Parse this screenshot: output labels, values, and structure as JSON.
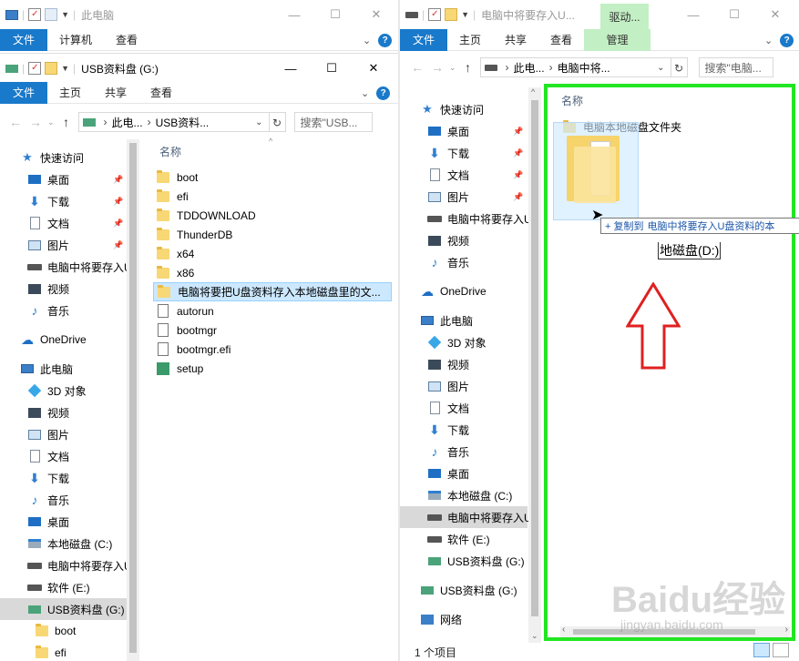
{
  "left_top_window": {
    "title": "此电脑",
    "ribbon_tabs": [
      "文件",
      "计算机",
      "查看"
    ],
    "controls": {
      "minimize": "—",
      "maximize": "☐",
      "close": "✕"
    }
  },
  "left_window": {
    "title": "USB资料盘 (G:)",
    "ribbon_tabs": [
      "文件",
      "主页",
      "共享",
      "查看"
    ],
    "address": {
      "crumb1": "此电...",
      "crumb2": "USB资料...",
      "refresh": "↻"
    },
    "search_placeholder": "搜索\"USB...",
    "nav": [
      {
        "label": "快速访问",
        "icon": "star-icon",
        "level": 0
      },
      {
        "label": "桌面",
        "icon": "desktop-icon",
        "level": 1,
        "pinned": true
      },
      {
        "label": "下载",
        "icon": "download-icon",
        "level": 1,
        "pinned": true
      },
      {
        "label": "文档",
        "icon": "document-icon",
        "level": 1,
        "pinned": true
      },
      {
        "label": "图片",
        "icon": "picture-icon",
        "level": 1,
        "pinned": true
      },
      {
        "label": "电脑中将要存入U",
        "icon": "drive-icon",
        "level": 1
      },
      {
        "label": "视频",
        "icon": "video-icon",
        "level": 1
      },
      {
        "label": "音乐",
        "icon": "music-icon",
        "level": 1
      },
      {
        "label": "OneDrive",
        "icon": "cloud-icon",
        "level": 0
      },
      {
        "label": "此电脑",
        "icon": "computer-icon",
        "level": 0
      },
      {
        "label": "3D 对象",
        "icon": "cube-icon",
        "level": 1
      },
      {
        "label": "视频",
        "icon": "video-icon",
        "level": 1
      },
      {
        "label": "图片",
        "icon": "picture-icon",
        "level": 1
      },
      {
        "label": "文档",
        "icon": "document-icon",
        "level": 1
      },
      {
        "label": "下载",
        "icon": "download-icon",
        "level": 1
      },
      {
        "label": "音乐",
        "icon": "music-icon",
        "level": 1
      },
      {
        "label": "桌面",
        "icon": "desktop-icon",
        "level": 1
      },
      {
        "label": "本地磁盘 (C:)",
        "icon": "windows-drive-icon",
        "level": 1
      },
      {
        "label": "电脑中将要存入U",
        "icon": "drive-icon",
        "level": 1
      },
      {
        "label": "软件 (E:)",
        "icon": "drive-icon",
        "level": 1
      },
      {
        "label": "USB资料盘 (G:)",
        "icon": "usb-drive-icon",
        "level": 1,
        "selected": true
      },
      {
        "label": "boot",
        "icon": "folder-icon",
        "level": 2
      },
      {
        "label": "efi",
        "icon": "folder-icon",
        "level": 2
      }
    ],
    "column_header": "名称",
    "files": [
      {
        "name": "boot",
        "type": "folder"
      },
      {
        "name": "efi",
        "type": "folder"
      },
      {
        "name": "TDDOWNLOAD",
        "type": "folder"
      },
      {
        "name": "ThunderDB",
        "type": "folder"
      },
      {
        "name": "x64",
        "type": "folder"
      },
      {
        "name": "x86",
        "type": "folder"
      },
      {
        "name": "电脑将要把U盘资料存入本地磁盘里的文...",
        "type": "folder",
        "selected": true
      },
      {
        "name": "autorun",
        "type": "file"
      },
      {
        "name": "bootmgr",
        "type": "file"
      },
      {
        "name": "bootmgr.efi",
        "type": "file"
      },
      {
        "name": "setup",
        "type": "setup"
      }
    ]
  },
  "right_window": {
    "title": "电脑中将要存入U...",
    "context_tab": "驱动...",
    "ribbon_tabs": [
      "文件",
      "主页",
      "共享",
      "查看"
    ],
    "ribbon_manage": "管理",
    "address": {
      "crumb1": "此电...",
      "crumb2": "电脑中将...",
      "refresh": "↻"
    },
    "search_placeholder": "搜索\"电脑...",
    "nav": [
      {
        "label": "快速访问",
        "icon": "star-icon",
        "level": 0
      },
      {
        "label": "桌面",
        "icon": "desktop-icon",
        "level": 1,
        "pinned": true
      },
      {
        "label": "下载",
        "icon": "download-icon",
        "level": 1,
        "pinned": true
      },
      {
        "label": "文档",
        "icon": "document-icon",
        "level": 1,
        "pinned": true
      },
      {
        "label": "图片",
        "icon": "picture-icon",
        "level": 1,
        "pinned": true
      },
      {
        "label": "电脑中将要存入U",
        "icon": "drive-icon",
        "level": 1
      },
      {
        "label": "视频",
        "icon": "video-icon",
        "level": 1
      },
      {
        "label": "音乐",
        "icon": "music-icon",
        "level": 1
      },
      {
        "label": "OneDrive",
        "icon": "cloud-icon",
        "level": 0
      },
      {
        "label": "此电脑",
        "icon": "computer-icon",
        "level": 0
      },
      {
        "label": "3D 对象",
        "icon": "cube-icon",
        "level": 1
      },
      {
        "label": "视频",
        "icon": "video-icon",
        "level": 1
      },
      {
        "label": "图片",
        "icon": "picture-icon",
        "level": 1
      },
      {
        "label": "文档",
        "icon": "document-icon",
        "level": 1
      },
      {
        "label": "下载",
        "icon": "download-icon",
        "level": 1
      },
      {
        "label": "音乐",
        "icon": "music-icon",
        "level": 1
      },
      {
        "label": "桌面",
        "icon": "desktop-icon",
        "level": 1
      },
      {
        "label": "本地磁盘 (C:)",
        "icon": "windows-drive-icon",
        "level": 1
      },
      {
        "label": "电脑中将要存入U",
        "icon": "drive-icon",
        "level": 1,
        "selected": true
      },
      {
        "label": "软件 (E:)",
        "icon": "drive-icon",
        "level": 1
      },
      {
        "label": "USB资料盘 (G:)",
        "icon": "usb-drive-icon",
        "level": 1
      },
      {
        "label": "USB资料盘 (G:)",
        "icon": "usb-drive-icon",
        "level": 0
      },
      {
        "label": "网络",
        "icon": "network-icon",
        "level": 0
      }
    ],
    "column_header": "名称",
    "files": [
      {
        "name": "电脑本地磁盘文件夹",
        "type": "folder"
      }
    ],
    "drag_tooltip": {
      "prefix": "+ 复制到",
      "target": "电脑中将要存入U盘资料的本"
    },
    "annotation_label": "地磁盘(D:)",
    "status": "1 个项目"
  },
  "colors": {
    "accent": "#1979ca",
    "highlight_green": "#22e622",
    "arrow_red": "#e02020",
    "selection": "#cce8ff"
  },
  "watermark": {
    "brand": "Baidu经验",
    "url": "jingyan.baidu.com"
  }
}
